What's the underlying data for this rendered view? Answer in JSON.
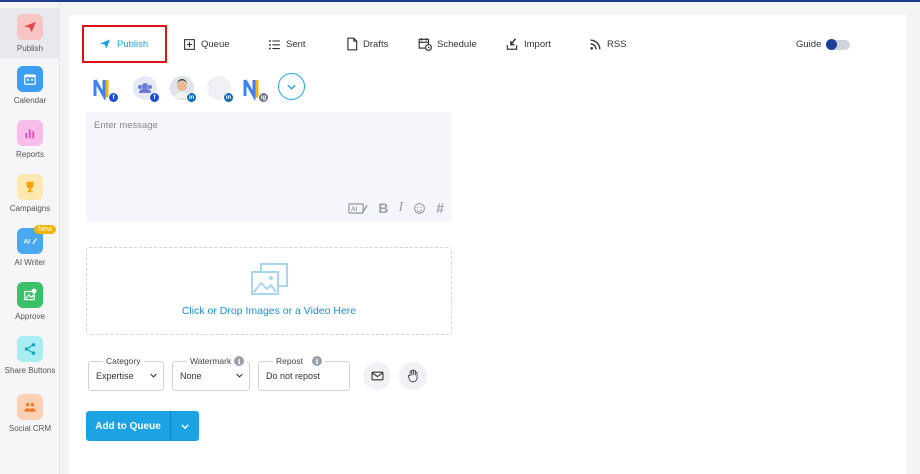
{
  "sidebar": {
    "items": [
      {
        "label": "Publish",
        "icon": "paper-plane-icon",
        "color": "#f4a8a8",
        "active": true
      },
      {
        "label": "Calendar",
        "icon": "calendar-icon",
        "color": "#3b9ef0"
      },
      {
        "label": "Reports",
        "icon": "bar-chart-icon",
        "color": "#f38ad8"
      },
      {
        "label": "Campaigns",
        "icon": "trophy-icon",
        "color": "#f7c948"
      },
      {
        "label": "AI Writer",
        "icon": "ai-pen-icon",
        "color": "#4aa8f0",
        "badge": "New"
      },
      {
        "label": "Approve",
        "icon": "image-check-icon",
        "color": "#3cc06a"
      },
      {
        "label": "Share Buttons",
        "icon": "share-icon",
        "color": "#22c7d4"
      },
      {
        "label": "Social CRM",
        "icon": "people-icon",
        "color": "#f59a5a"
      }
    ]
  },
  "tabs": [
    {
      "label": "Publish",
      "icon": "paper-plane-icon",
      "active": true
    },
    {
      "label": "Queue",
      "icon": "plus-square-icon"
    },
    {
      "label": "Sent",
      "icon": "list-icon"
    },
    {
      "label": "Drafts",
      "icon": "document-icon"
    },
    {
      "label": "Schedule",
      "icon": "calendar-clock-icon"
    },
    {
      "label": "Import",
      "icon": "import-icon"
    },
    {
      "label": "RSS",
      "icon": "rss-icon"
    }
  ],
  "guide": {
    "label": "Guide",
    "enabled": true
  },
  "accounts": [
    {
      "network": "f",
      "type": "logo"
    },
    {
      "network": "f",
      "type": "group"
    },
    {
      "network": "in",
      "type": "photo"
    },
    {
      "network": "in",
      "type": "blank"
    },
    {
      "network": "ig",
      "type": "logo"
    }
  ],
  "message": {
    "placeholder": "Enter message",
    "value": ""
  },
  "dropzone": {
    "text": "Click or Drop Images or a Video Here"
  },
  "fields": {
    "category": {
      "legend": "Category",
      "value": "Expertise"
    },
    "watermark": {
      "legend": "Watermark",
      "value": "None"
    },
    "repost": {
      "legend": "Repost",
      "value": "Do not repost"
    }
  },
  "add_button": {
    "label": "Add to Queue"
  },
  "colors": {
    "accent": "#1ca3e3",
    "highlight": "#d81414",
    "toggle": "#1d3f9a"
  }
}
